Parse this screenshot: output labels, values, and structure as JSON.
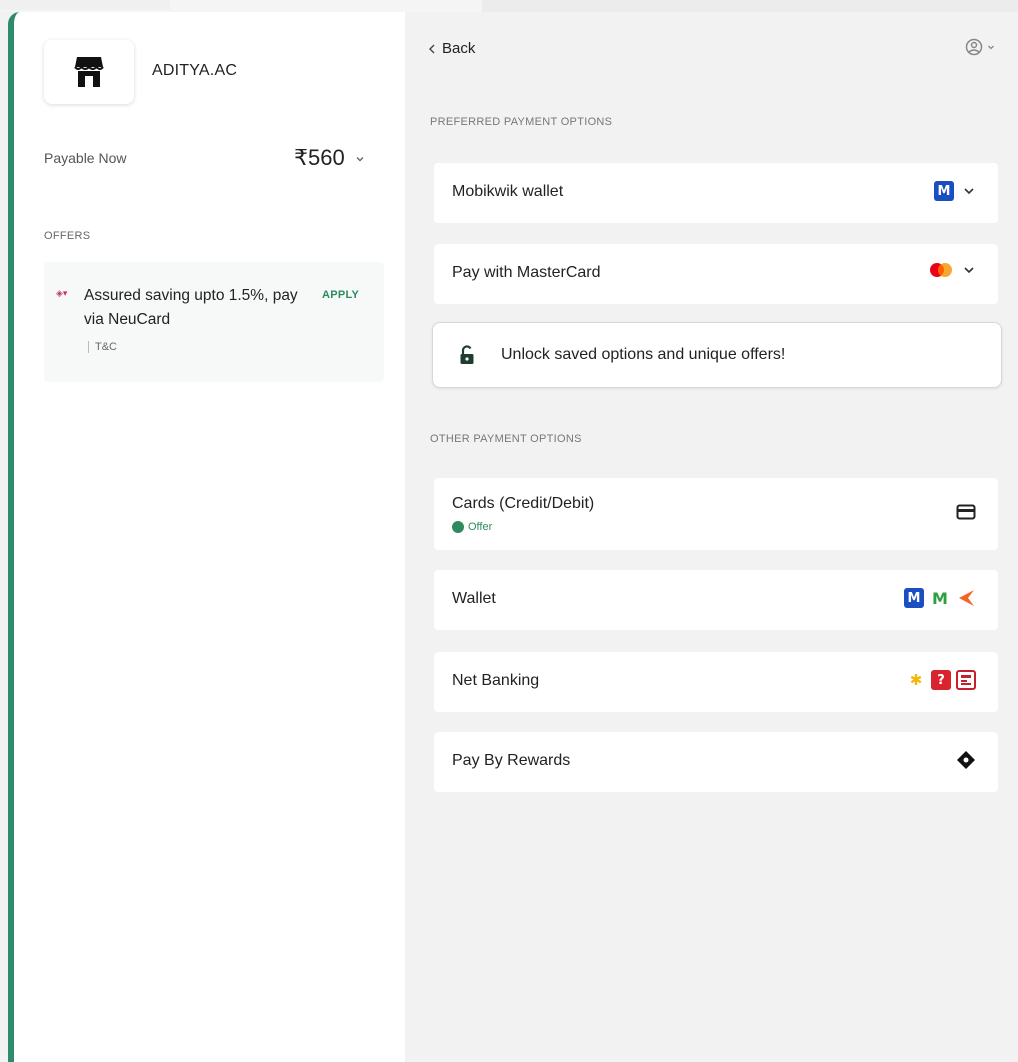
{
  "merchant": {
    "name": "ADITYA.AC"
  },
  "payable": {
    "label": "Payable Now",
    "amount": "₹560"
  },
  "offers": {
    "title": "OFFERS",
    "items": [
      {
        "text": "Assured saving upto 1.5%, pay via NeuCard",
        "action": "APPLY",
        "tnc": "T&C",
        "icon": "neucoin-icon"
      }
    ]
  },
  "header": {
    "back_label": "Back"
  },
  "preferred": {
    "title": "PREFERRED PAYMENT OPTIONS",
    "items": [
      {
        "label": "Mobikwik wallet",
        "icon": "mobikwik-icon"
      },
      {
        "label": "Pay with MasterCard",
        "icon": "mastercard-icon"
      }
    ]
  },
  "unlock": {
    "text": "Unlock saved options and unique offers!"
  },
  "other": {
    "title": "OTHER PAYMENT OPTIONS",
    "items": [
      {
        "label": "Cards (Credit/Debit)",
        "badge": "Offer",
        "icon": "card-icon"
      },
      {
        "label": "Wallet",
        "icons": [
          "mobikwik-icon",
          "m-wallet-icon",
          "freecharge-icon"
        ]
      },
      {
        "label": "Net Banking",
        "icons": [
          "bank-icon",
          "bank-icon",
          "bank-icon"
        ]
      },
      {
        "label": "Pay By Rewards",
        "icon": "rewards-icon"
      }
    ]
  },
  "colors": {
    "accent": "#2e8b6b",
    "offer_green": "#2e8b5f",
    "panel_bg": "#f2f2f2",
    "card_bg": "#ffffff"
  }
}
